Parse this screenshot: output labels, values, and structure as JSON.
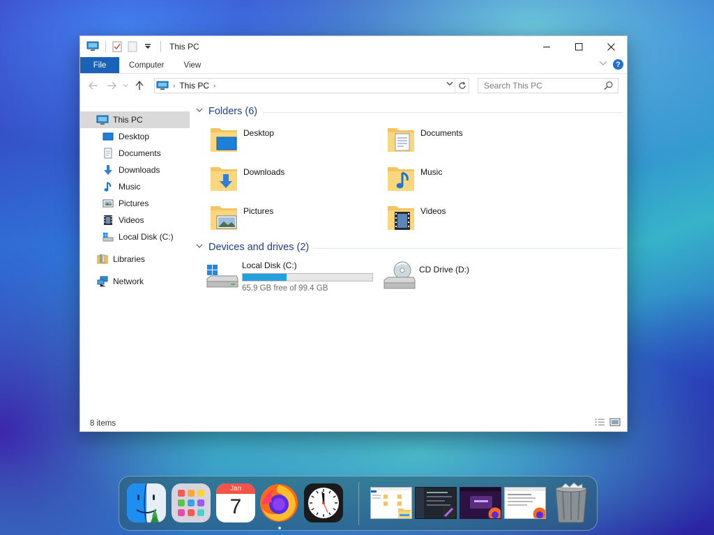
{
  "window": {
    "title": "This PC",
    "controls": {
      "minimize": "—",
      "maximize": "☐",
      "close": "✕"
    }
  },
  "ribbon": {
    "tabs": [
      {
        "label": "File",
        "active": true
      },
      {
        "label": "Computer"
      },
      {
        "label": "View"
      }
    ],
    "help": "?"
  },
  "navigation": {
    "breadcrumb": [
      "This PC"
    ],
    "search_placeholder": "Search This PC"
  },
  "sidebar": {
    "items": [
      {
        "label": "This PC",
        "icon": "monitor-icon",
        "selected": true
      },
      {
        "label": "Desktop",
        "icon": "desktop-icon"
      },
      {
        "label": "Documents",
        "icon": "documents-icon"
      },
      {
        "label": "Downloads",
        "icon": "downloads-icon"
      },
      {
        "label": "Music",
        "icon": "music-icon"
      },
      {
        "label": "Pictures",
        "icon": "pictures-icon"
      },
      {
        "label": "Videos",
        "icon": "videos-icon"
      },
      {
        "label": "Local Disk (C:)",
        "icon": "drive-icon"
      },
      {
        "label": "Libraries",
        "icon": "libraries-icon"
      },
      {
        "label": "Network",
        "icon": "network-icon"
      }
    ]
  },
  "folders": {
    "header": "Folders (6)",
    "items": [
      {
        "label": "Desktop",
        "icon": "desktop-folder-icon"
      },
      {
        "label": "Documents",
        "icon": "documents-folder-icon"
      },
      {
        "label": "Downloads",
        "icon": "downloads-folder-icon"
      },
      {
        "label": "Music",
        "icon": "music-folder-icon"
      },
      {
        "label": "Pictures",
        "icon": "pictures-folder-icon"
      },
      {
        "label": "Videos",
        "icon": "videos-folder-icon"
      }
    ]
  },
  "drives": {
    "header": "Devices and drives (2)",
    "items": [
      {
        "label": "Local Disk (C:)",
        "free_text": "65.9 GB free of 99.4 GB",
        "used_fraction": 0.337,
        "icon": "windows-drive-icon"
      },
      {
        "label": "CD Drive (D:)",
        "icon": "cd-drive-icon"
      }
    ]
  },
  "status": {
    "items_count": "8 items"
  },
  "dock": {
    "apps": [
      {
        "name": "finder",
        "icon": "finder-icon"
      },
      {
        "name": "launchpad",
        "icon": "launchpad-icon"
      },
      {
        "name": "calendar",
        "icon": "calendar-icon",
        "month": "Jan",
        "day": "7"
      },
      {
        "name": "firefox",
        "icon": "firefox-icon",
        "running": true
      },
      {
        "name": "clock",
        "icon": "clock-icon"
      }
    ],
    "trash_icon": "trash-icon"
  },
  "colors": {
    "file_tab": "#1a62b8",
    "group_header": "#1e3f8a",
    "bar_fill": "#26a0da",
    "selected_bg": "#d9d9d9"
  }
}
